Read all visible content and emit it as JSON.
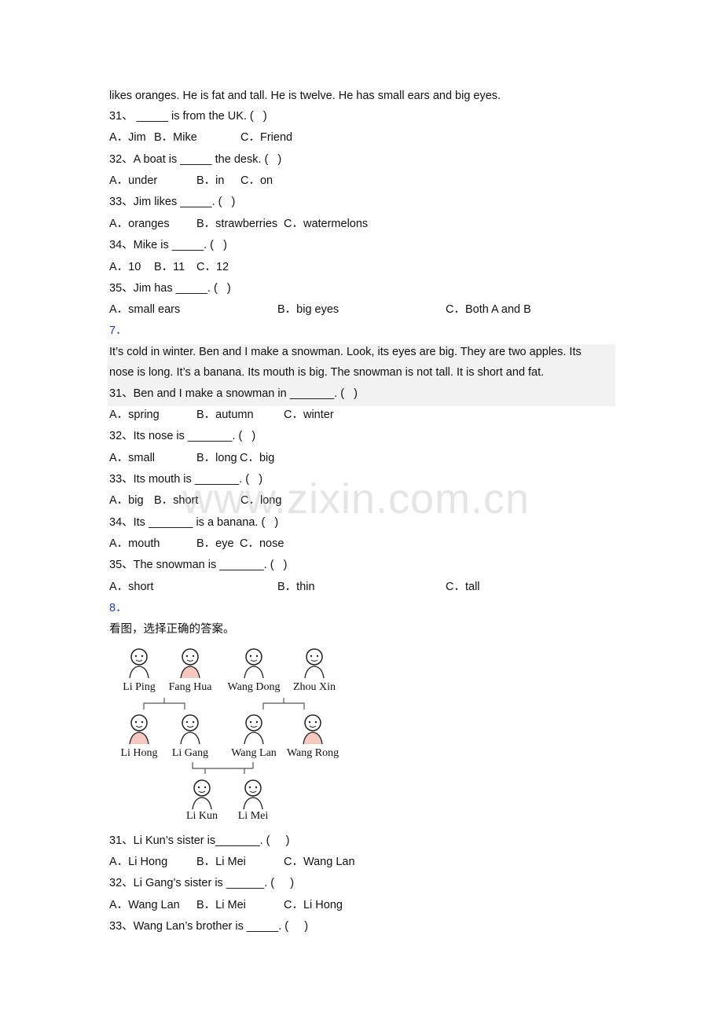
{
  "intro_tail": "likes oranges. He is fat and tall. He is twelve. He has small ears and big eyes.",
  "s6": {
    "q": [
      "31、 _____ is from the UK. (   )",
      "32、A boat is _____ the desk. (   )",
      "33、Jim likes _____. (   )",
      "34、Mike is _____. (   )",
      "35、Jim has _____. (   )"
    ],
    "o": [
      [
        "A．Jim",
        "B．Mike",
        "C．Friend"
      ],
      [
        "A．under",
        "B．in",
        "C．on"
      ],
      [
        "A．oranges",
        "B．strawberries",
        "C．watermelons"
      ],
      [
        "A．10",
        "B．11",
        "C．12"
      ],
      [
        "A．small ears",
        "B．big eyes",
        "C．Both A and B"
      ]
    ]
  },
  "s7": {
    "number": "7．",
    "passage1": "It’s cold in winter. Ben and I make a snowman. Look, its eyes are big. They are two apples. Its",
    "passage2": "nose is long. It’s a banana. Its mouth is big. The snowman is not tall. It is short and fat.",
    "q": [
      "31、Ben and I make a snowman in _______. (   )",
      "32、Its nose is _______. (   )",
      "33、Its mouth is _______. (   )",
      "34、Its _______ is a banana. (   )",
      "35、The snowman is _______. (   )"
    ],
    "o": [
      [
        "A．spring",
        "B．autumn",
        "C．winter"
      ],
      [
        "A．small",
        "B．long",
        "C．big"
      ],
      [
        "A．big",
        "B．short",
        "C．long"
      ],
      [
        "A．mouth",
        "B．eye",
        "C．nose"
      ],
      [
        "A．short",
        "B．thin",
        "C．tall"
      ]
    ]
  },
  "s8": {
    "number": "8．",
    "instruction": "看图，选择正确的答案。",
    "family": [
      "Li Ping",
      "Fang Hua",
      "Wang Dong",
      "Zhou Xin",
      "Li Hong",
      "Li Gang",
      "Wang Lan",
      "Wang Rong",
      "Li Kun",
      "Li Mei"
    ],
    "q": [
      "31、Li Kun’s sister is_______. (     )",
      "32、Li Gang’s sister is ______. (     )",
      "33、Wang Lan’s brother is _____. (     )"
    ],
    "o": [
      [
        "A．Li Hong",
        "B．Li Mei",
        "C．Wang Lan"
      ],
      [
        "A．Wang Lan",
        "B．Li Mei",
        "C．Li Hong"
      ]
    ]
  },
  "watermark": "www.zixin.com.cn"
}
